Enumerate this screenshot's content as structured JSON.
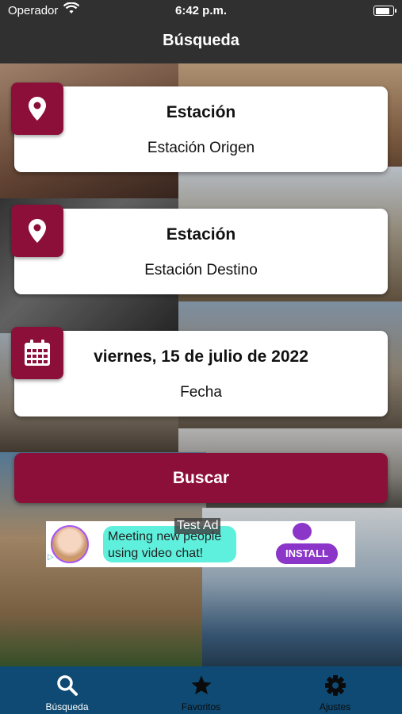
{
  "status_bar": {
    "carrier": "Operador",
    "time": "6:42 p.m.",
    "battery_level": 0.9
  },
  "nav": {
    "title": "Búsqueda"
  },
  "origin": {
    "heading": "Estación",
    "value": "Estación Origen",
    "icon": "location-pin-icon"
  },
  "destination": {
    "heading": "Estación",
    "value": "Estación Destino",
    "icon": "location-pin-icon"
  },
  "date": {
    "heading": "viernes, 15 de julio de 2022",
    "value": "Fecha",
    "icon": "calendar-icon"
  },
  "search_button": {
    "label": "Buscar"
  },
  "ad": {
    "tag": "Test Ad",
    "message": "Meeting new people using video chat!",
    "install": "INSTALL"
  },
  "tabs": [
    {
      "label": "Búsqueda",
      "icon": "search-icon",
      "active": true
    },
    {
      "label": "Favoritos",
      "icon": "star-icon",
      "active": false
    },
    {
      "label": "Ajustes",
      "icon": "gear-icon",
      "active": false
    }
  ],
  "colors": {
    "accent": "#8c0f39",
    "tab_bar": "#0e4a73",
    "nav_bar": "#303030"
  }
}
